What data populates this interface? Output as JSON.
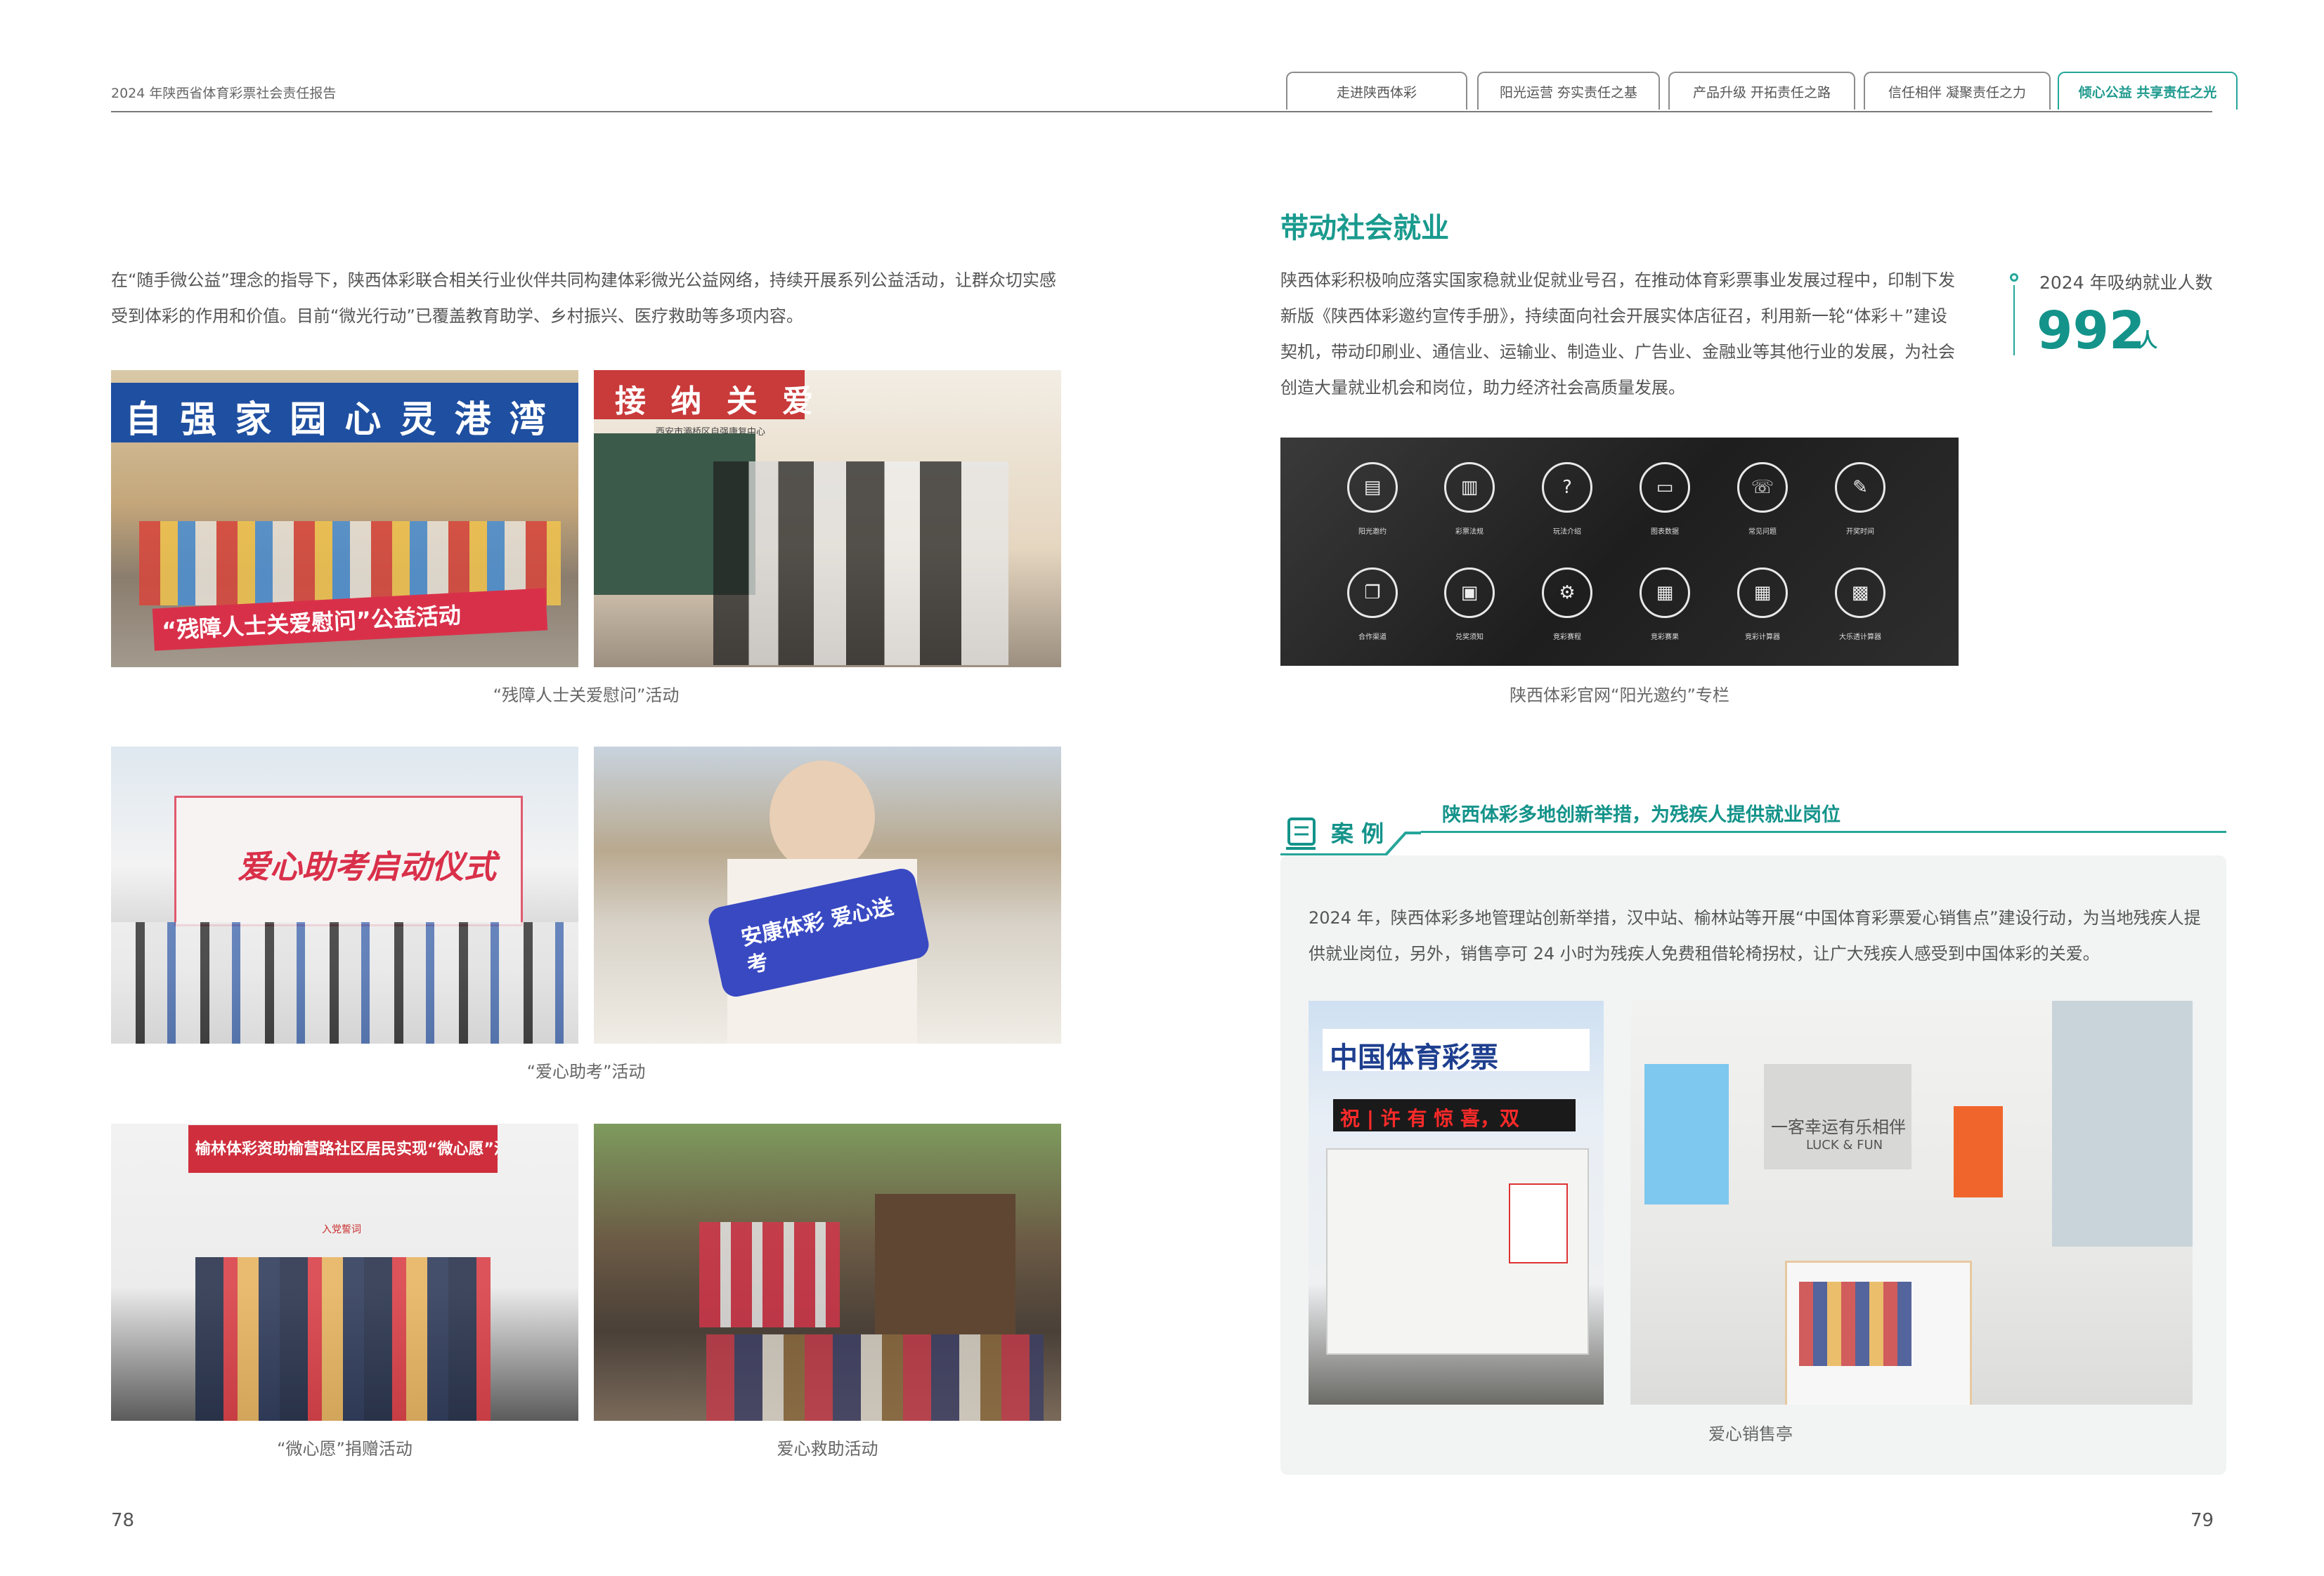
{
  "header": {
    "report_title": "2024 年陕西省体育彩票社会责任报告",
    "tabs": [
      "走进陕西体彩",
      "阳光运营 夯实责任之基",
      "产品升级 开拓责任之路",
      "信任相伴 凝聚责任之力",
      "倾心公益 共享责任之光"
    ],
    "active_tab": "倾心公益 共享责任之光"
  },
  "left": {
    "intro": "在“随手微公益”理念的指导下，陕西体彩联合相关行业伙伴共同构建体彩微光公益网络，持续开展系列公益活动，让群众切实感受到体彩的作用和价值。目前“微光行动”已覆盖教育助学、乡村振兴、医疗救助等多项内容。",
    "photos": {
      "p1_sign": "自 强 家 园 心 灵 港 湾",
      "p1_banner": "“残障人士关爱慰问”公益活动",
      "p2_sign": "接 纳 关 爱",
      "p2_sub": "西安市灞桥区自强康复中心",
      "p3_banner": "爱心助考启动仪式",
      "p4_sign": "安康体彩 爱心送考",
      "p5_banner": "榆林体彩资助榆营路社区居民实现“微心愿”活动",
      "p5_sub": "入党誓词"
    },
    "captions": {
      "row1": "“残障人士关爱慰问”活动",
      "row2": "“爱心助考”活动",
      "row3_left": "“微心愿”捐赠活动",
      "row3_right": "爱心救助活动"
    },
    "page_number": "78"
  },
  "right": {
    "section_title": "带动社会就业",
    "body": "陕西体彩积极响应落实国家稳就业促就业号召，在推动体育彩票事业发展过程中，印制下发新版《陕西体彩邀约宣传手册》，持续面向社会开展实体店征召，利用新一轮“体彩＋”建设契机，带动印刷业、通信业、运输业、制造业、广告业、金融业等其他行业的发展，为社会创造大量就业机会和岗位，助力经济社会高质量发展。",
    "stat": {
      "label": "2024 年吸纳就业人数",
      "value": "992",
      "unit": "人"
    },
    "website": {
      "caption": "陕西体彩官网“阳光邀约”专栏",
      "icons": [
        {
          "icon": "document-icon",
          "glyph": "▤",
          "label": "阳光邀约"
        },
        {
          "icon": "chart-icon",
          "glyph": "▥",
          "label": "彩票法规"
        },
        {
          "icon": "question-icon",
          "glyph": "?",
          "label": "玩法介绍"
        },
        {
          "icon": "chat-icon",
          "glyph": "▭",
          "label": "图表数据"
        },
        {
          "icon": "phone-icon",
          "glyph": "☏",
          "label": "常见问题"
        },
        {
          "icon": "calendar-edit-icon",
          "glyph": "✎",
          "label": "开奖时间"
        },
        {
          "icon": "copy-icon",
          "glyph": "❐",
          "label": "合作渠道"
        },
        {
          "icon": "card-icon",
          "glyph": "▣",
          "label": "兑奖须知"
        },
        {
          "icon": "gear-icon",
          "glyph": "⚙",
          "label": "竞彩赛程"
        },
        {
          "icon": "calendar-icon",
          "glyph": "▦",
          "label": "竞彩赛果"
        },
        {
          "icon": "grid-icon",
          "glyph": "▦",
          "label": "竞彩计算器"
        },
        {
          "icon": "calculator-icon",
          "glyph": "▩",
          "label": "大乐透计算器"
        }
      ]
    },
    "case": {
      "tag": "案 例",
      "title": "陕西体彩多地创新举措，为残疾人提供就业岗位",
      "body": "2024 年，陕西体彩多地管理站创新举措，汉中站、榆林站等开展“中国体育彩票爱心销售点”建设行动，为当地残疾人提供就业岗位，另外，销售亭可 24 小时为残疾人免费租借轮椅拐杖，让广大残疾人感受到中国体彩的关爱。",
      "kiosk_sign": "中国体育彩票",
      "kiosk_led": "祝 | 许 有 惊 喜，双",
      "store_sign": "一客幸运有乐相伴",
      "store_sub": "LUCK & FUN",
      "caption": "爱心销售亭"
    },
    "page_number": "79"
  },
  "colors": {
    "accent": "#14938a",
    "accent_light": "#26a69a",
    "text": "#555555"
  }
}
